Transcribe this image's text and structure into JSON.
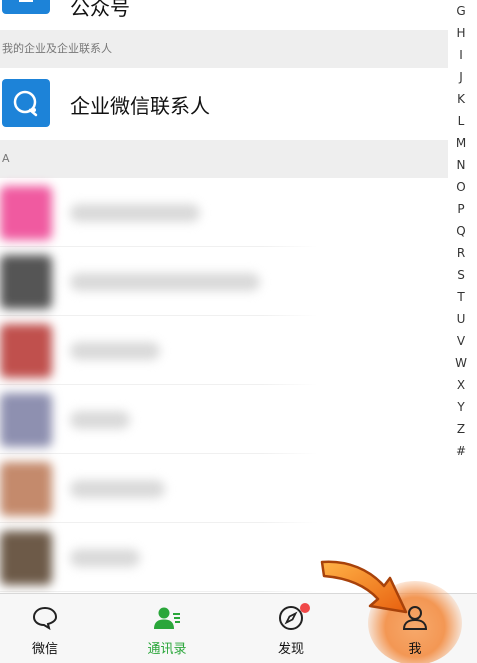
{
  "top_row": {
    "label": "公众号"
  },
  "section_enterprise": {
    "label": "我的企业及企业联系人"
  },
  "enterprise_row": {
    "label": "企业微信联系人"
  },
  "section_a": {
    "label": "A"
  },
  "contacts": [
    {
      "avatar_color": "#f05aa0",
      "name_width": 130
    },
    {
      "avatar_color": "#555555",
      "name_width": 190
    },
    {
      "avatar_color": "#c0504d",
      "name_width": 90
    },
    {
      "avatar_color": "#8e90b0",
      "name_width": 60
    },
    {
      "avatar_color": "#c48a6c",
      "name_width": 95
    },
    {
      "avatar_color": "#6d5a48",
      "name_width": 70
    }
  ],
  "index_letters": [
    "G",
    "H",
    "I",
    "J",
    "K",
    "L",
    "M",
    "N",
    "O",
    "P",
    "Q",
    "R",
    "S",
    "T",
    "U",
    "V",
    "W",
    "X",
    "Y",
    "Z",
    "#"
  ],
  "tabs": [
    {
      "label": "微信",
      "icon": "chat-bubble-icon"
    },
    {
      "label": "通讯录",
      "icon": "contacts-icon"
    },
    {
      "label": "发现",
      "icon": "compass-icon"
    },
    {
      "label": "我",
      "icon": "person-icon"
    }
  ],
  "colors": {
    "accent_green": "#2aa63a",
    "enterprise_blue": "#1d83d8",
    "badge_red": "#f04848",
    "highlight_orange": "#f39754"
  }
}
